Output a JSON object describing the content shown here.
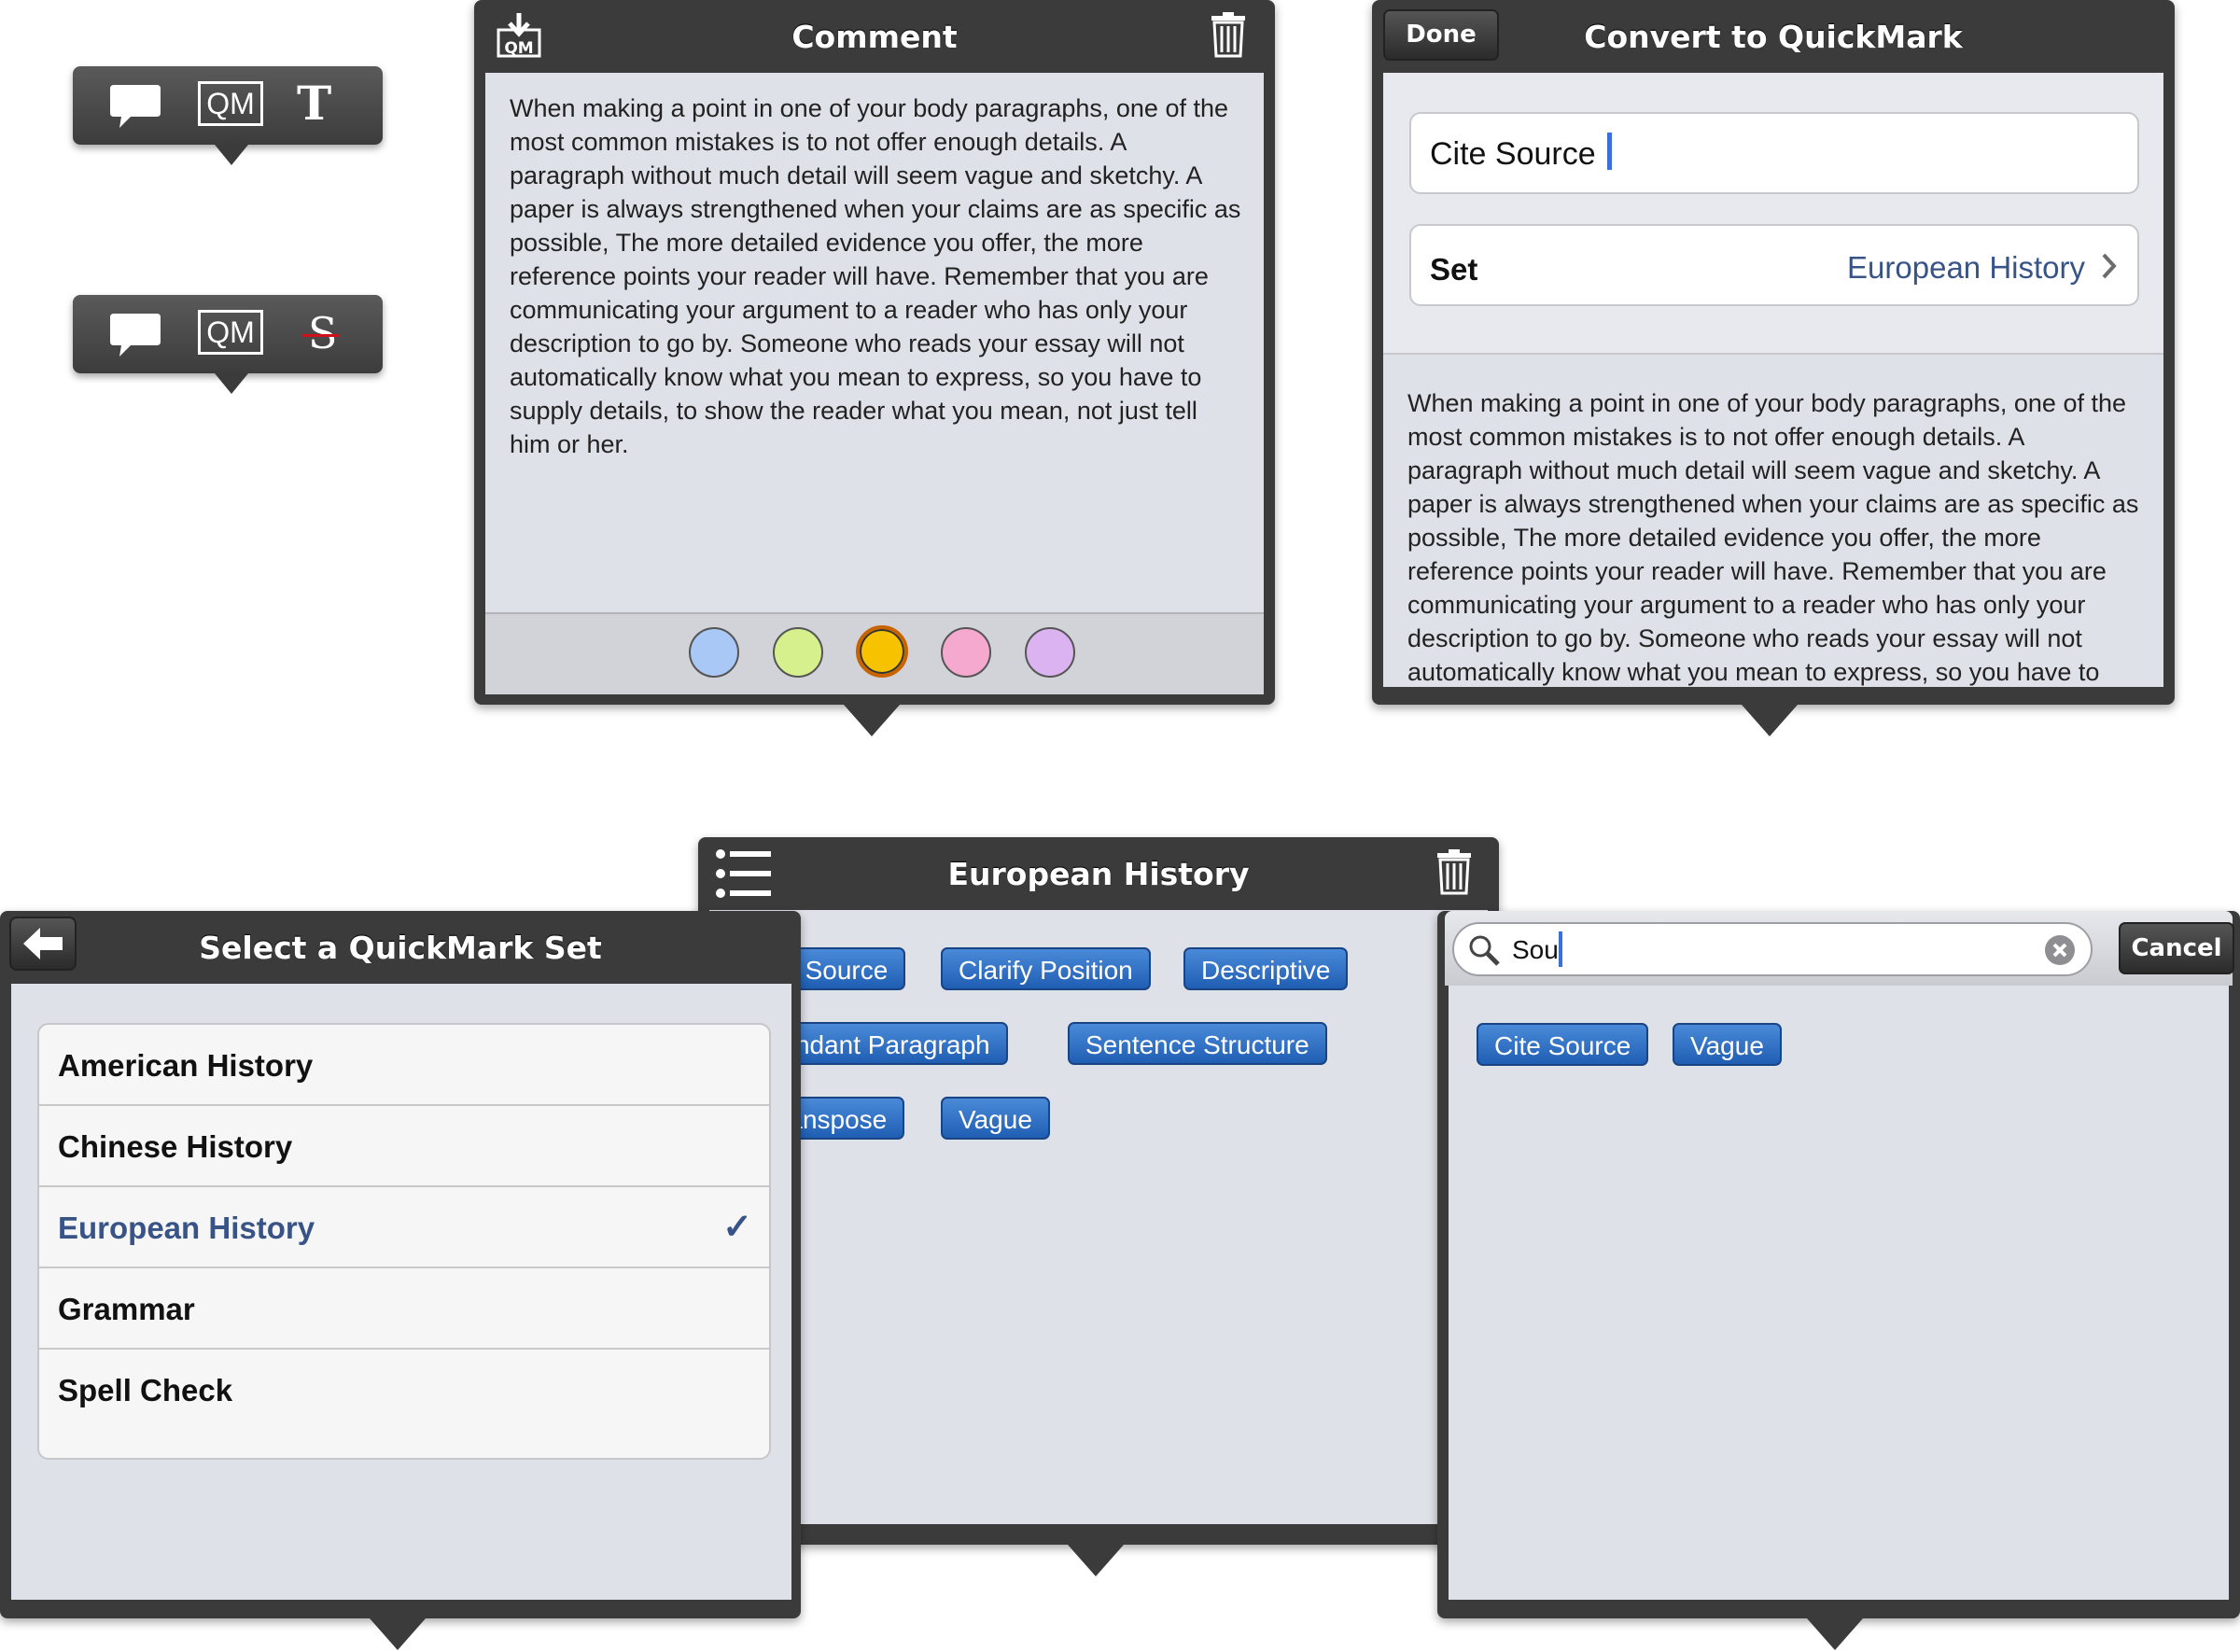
{
  "toolbars": [
    {
      "comment_icon": "speech-bubble-icon",
      "qm_label": "QM",
      "third_label": "T"
    },
    {
      "comment_icon": "speech-bubble-icon",
      "qm_label": "QM",
      "third_label": "S"
    }
  ],
  "comment_popover": {
    "title": "Comment",
    "body": "When making a point in one of your body paragraphs, one of the most common mistakes is to not offer enough details. A paragraph without much detail will seem vague and sketchy. A paper is always strengthened when your claims are as specific as possible, The more detailed evidence you offer, the more reference points your reader will have. Remember that you are communicating your argument to a reader who has only your description to go by. Someone who reads your essay will not automatically know what you mean to express, so you have to supply details, to show the reader what you mean, not just tell him or her.",
    "colors": [
      "#a9c8f5",
      "#d5f08c",
      "#f7c300",
      "#f6a9cf",
      "#dcb3f1"
    ],
    "selected_color_index": 2
  },
  "convert_popover": {
    "done_label": "Done",
    "title": "Convert to QuickMark",
    "name_value": "Cite Source",
    "set_label": "Set",
    "set_value": "European History",
    "body": "When making a point in one of your body paragraphs, one of the most common mistakes is to not offer enough details. A paragraph without much detail will seem vague and sketchy. A paper is always strengthened when your claims are as specific as possible, The more detailed evidence you offer, the more reference points your reader will have. Remember that you are communicating your argument to a reader who has only your description to go by. Someone who reads your essay will not automatically know what you mean to express, so you have to"
  },
  "set_popover": {
    "title": "European History",
    "tags_row1": [
      "Cite Source",
      "Clarify Position",
      "Descriptive"
    ],
    "tags_row2": [
      "Redundant Paragraph",
      "Sentence Structure"
    ],
    "tags_row3": [
      "Transpose",
      "Vague"
    ]
  },
  "select_popover": {
    "title": "Select a QuickMark Set",
    "items": [
      "American History",
      "Chinese History",
      "European History",
      "Grammar",
      "Spell Check"
    ],
    "selected_index": 2,
    "checkmark": "✓"
  },
  "search_popover": {
    "query": "Sou",
    "cancel_label": "Cancel",
    "results": [
      "Cite Source",
      "Vague"
    ]
  },
  "colors": {
    "accent_blue": "#2f67c0",
    "link_blue": "#385487",
    "dark_bar": "#3b3b3b"
  }
}
